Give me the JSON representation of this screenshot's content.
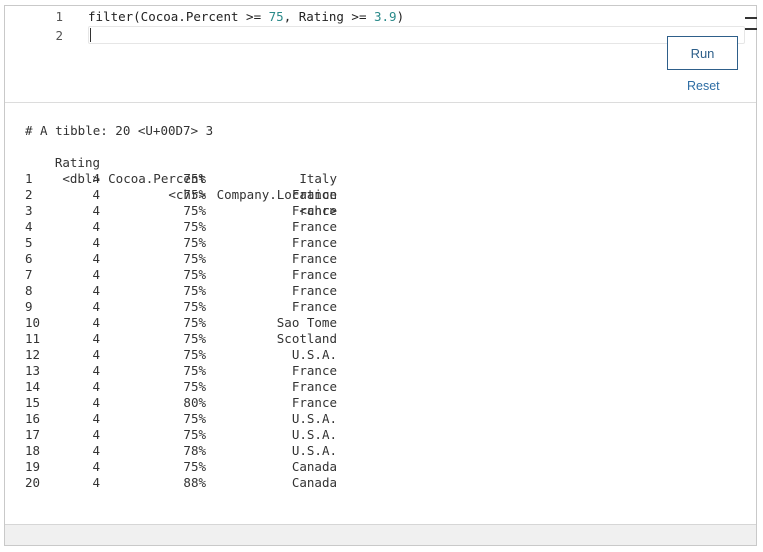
{
  "editor": {
    "line_numbers": [
      "1",
      "2"
    ],
    "code_parts": [
      "filter(Cocoa.Percent >= ",
      "75",
      ", Rating >= ",
      "3.9",
      ")"
    ],
    "line2": ""
  },
  "buttons": {
    "run_label": "Run",
    "reset_label": "Reset"
  },
  "output": {
    "summary": "# A tibble: 20 <U+00D7> 3",
    "headers": [
      "Rating",
      "Cocoa.Percent",
      "Company.Location"
    ],
    "types": [
      "<dbl>",
      "<chr>",
      "<chr>"
    ],
    "rows": [
      [
        "1",
        "4",
        "75%",
        "Italy"
      ],
      [
        "2",
        "4",
        "75%",
        "France"
      ],
      [
        "3",
        "4",
        "75%",
        "France"
      ],
      [
        "4",
        "4",
        "75%",
        "France"
      ],
      [
        "5",
        "4",
        "75%",
        "France"
      ],
      [
        "6",
        "4",
        "75%",
        "France"
      ],
      [
        "7",
        "4",
        "75%",
        "France"
      ],
      [
        "8",
        "4",
        "75%",
        "France"
      ],
      [
        "9",
        "4",
        "75%",
        "France"
      ],
      [
        "10",
        "4",
        "75%",
        "Sao Tome"
      ],
      [
        "11",
        "4",
        "75%",
        "Scotland"
      ],
      [
        "12",
        "4",
        "75%",
        "U.S.A."
      ],
      [
        "13",
        "4",
        "75%",
        "France"
      ],
      [
        "14",
        "4",
        "75%",
        "France"
      ],
      [
        "15",
        "4",
        "80%",
        "France"
      ],
      [
        "16",
        "4",
        "75%",
        "U.S.A."
      ],
      [
        "17",
        "4",
        "75%",
        "U.S.A."
      ],
      [
        "18",
        "4",
        "78%",
        "U.S.A."
      ],
      [
        "19",
        "4",
        "75%",
        "Canada"
      ],
      [
        "20",
        "4",
        "88%",
        "Canada"
      ]
    ]
  }
}
